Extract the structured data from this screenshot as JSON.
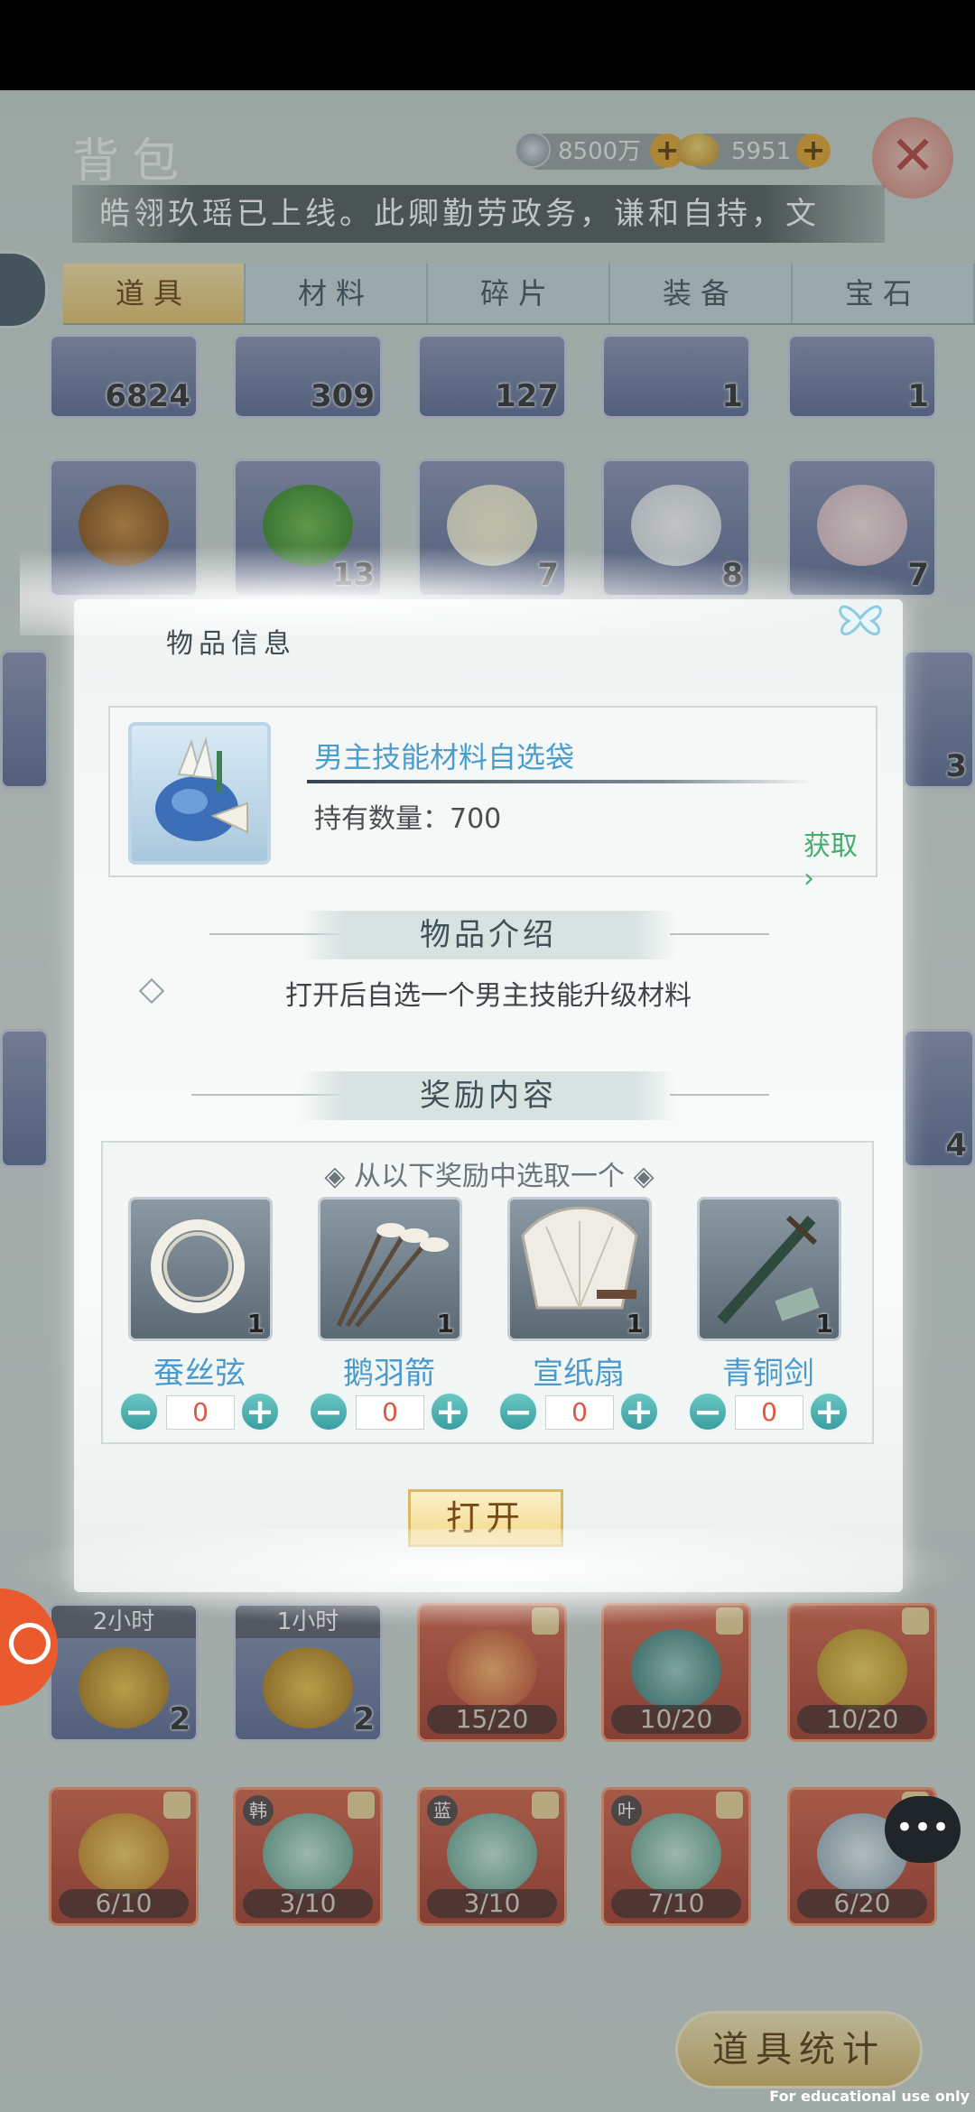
{
  "header": {
    "title": "背包",
    "silver": "8500万",
    "gold": "5951",
    "plus": "+",
    "close": "✕"
  },
  "marquee": "皓翎玖瑶已上线。此卿勤劳政务，谦和自持，文",
  "tabs": [
    {
      "label": "道具"
    },
    {
      "label": "材料"
    },
    {
      "label": "碎片"
    },
    {
      "label": "装备"
    },
    {
      "label": "宝石"
    }
  ],
  "grid": {
    "row1": [
      "6824",
      "309",
      "127",
      "1",
      "1"
    ],
    "row2": [
      "",
      "13",
      "7",
      "8",
      "7"
    ],
    "row_time": [
      {
        "tag": "2小时",
        "count": "2"
      },
      {
        "tag": "1小时",
        "count": "2"
      },
      {
        "progress": "15/20"
      },
      {
        "progress": "10/20"
      },
      {
        "progress": "10/20"
      }
    ],
    "row_frag": [
      {
        "tag": "",
        "progress": "6/10"
      },
      {
        "tag": "韩",
        "progress": "3/10"
      },
      {
        "tag": "蓝",
        "progress": "3/10"
      },
      {
        "tag": "叶",
        "progress": "7/10"
      },
      {
        "tag": "",
        "progress": "6/20"
      }
    ],
    "side_counts": [
      "3",
      "4"
    ]
  },
  "modal": {
    "title": "物品信息",
    "item_name": "男主技能材料自选袋",
    "item_count": "持有数量：700",
    "obtain": "获取",
    "intro_heading": "物品介绍",
    "description": "打开后自选一个男主技能升级材料",
    "reward_heading": "奖励内容",
    "choose_hint": "◈ 从以下奖励中选取一个 ◈",
    "rewards": [
      {
        "name": "蚕丝弦",
        "count": "1",
        "value": "0"
      },
      {
        "name": "鹅羽箭",
        "count": "1",
        "value": "0"
      },
      {
        "name": "宣纸扇",
        "count": "1",
        "value": "0"
      },
      {
        "name": "青铜剑",
        "count": "1",
        "value": "0"
      }
    ],
    "minus": "−",
    "plus": "+",
    "open_button": "打开"
  },
  "bottom": {
    "stats_button": "道具统计"
  },
  "watermark": "For educational use only",
  "colors": {
    "accent_blue": "#4b9ccf",
    "obtain_green": "#46ab6e",
    "tab_active": "#e6c26c"
  }
}
